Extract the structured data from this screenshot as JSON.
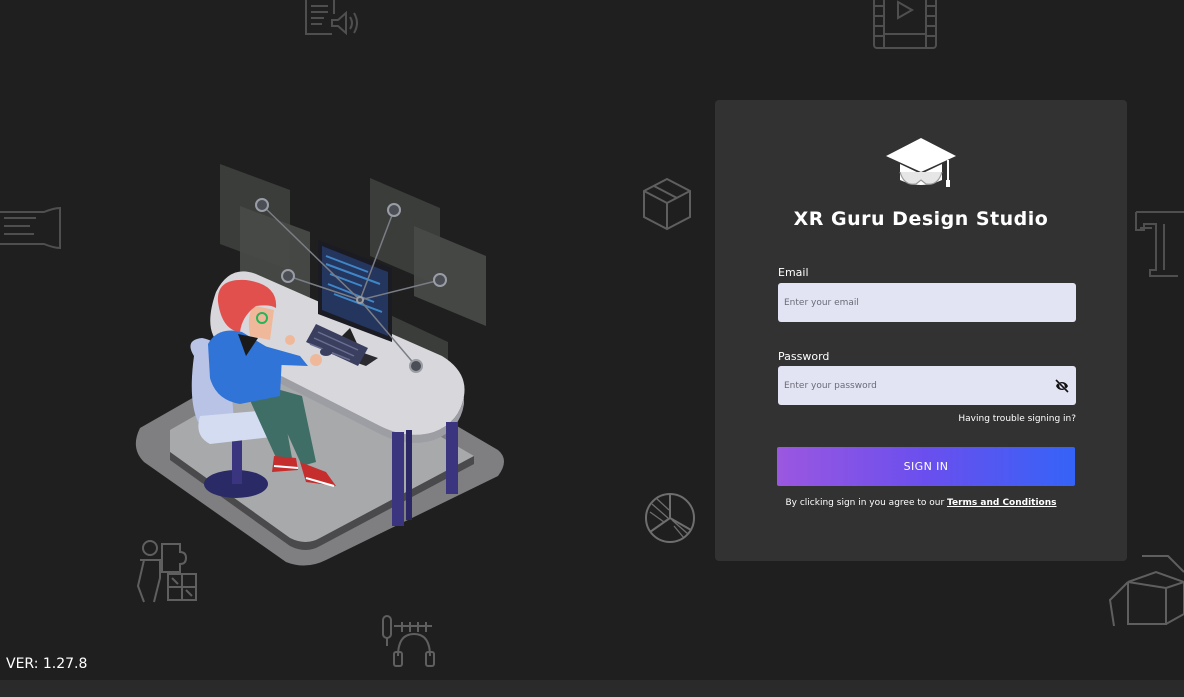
{
  "app": {
    "title": "XR Guru Design Studio",
    "logo_icon": "graduation-cap-vr-headset-icon"
  },
  "login": {
    "email_label": "Email",
    "email_placeholder": "Enter your email",
    "email_value": "",
    "password_label": "Password",
    "password_placeholder": "Enter your password",
    "password_value": "",
    "password_toggle_icon": "eye-off-icon",
    "trouble_link": "Having trouble signing in?",
    "signin_button": "SIGN IN",
    "terms_prefix": "By clicking sign in you agree to our",
    "terms_link": "Terms and Conditions"
  },
  "footer": {
    "version": "VER: 1.27.8"
  },
  "background_icons": [
    "document-audio-icon",
    "video-film-icon",
    "text-lines-icon",
    "cube-icon",
    "letter-t-icon",
    "pie-chart-icon",
    "puzzle-person-icon",
    "headphones-mic-icon",
    "open-box-icon"
  ],
  "illustration": "developer-at-desk-illustration",
  "colors": {
    "background": "#1f1f1f",
    "card": "#323232",
    "input": "#e3e4f3",
    "button_start": "#9b57e0",
    "button_end": "#3563f7"
  }
}
